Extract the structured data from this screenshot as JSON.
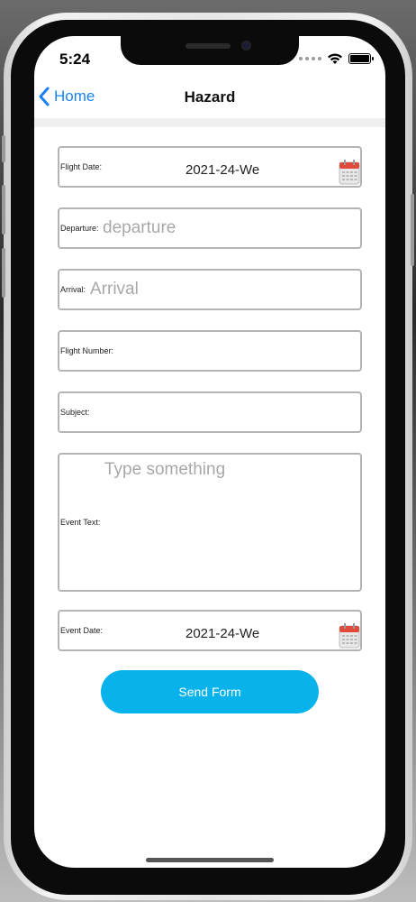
{
  "status_bar": {
    "time": "5:24"
  },
  "navbar": {
    "back_label": "Home",
    "title": "Hazard"
  },
  "form": {
    "flight_date": {
      "label": "Flight Date:",
      "value": "2021-24-We"
    },
    "departure": {
      "label": "Departure:",
      "placeholder": "departure"
    },
    "arrival": {
      "label": "Arrival:",
      "placeholder": "Arrival"
    },
    "flight_number": {
      "label": "Flight Number:"
    },
    "subject": {
      "label": "Subject:"
    },
    "event_text": {
      "label": "Event Text:",
      "placeholder": "Type something"
    },
    "event_date": {
      "label": "Event Date:",
      "value": "2021-24-We"
    },
    "send_label": "Send Form"
  },
  "colors": {
    "accent": "#1a82f0",
    "button": "#07b3ea",
    "calendar_red": "#e04a3c"
  },
  "icons": [
    "chevron-left-icon",
    "calendar-icon",
    "wifi-icon",
    "battery-icon",
    "signal-icon"
  ]
}
